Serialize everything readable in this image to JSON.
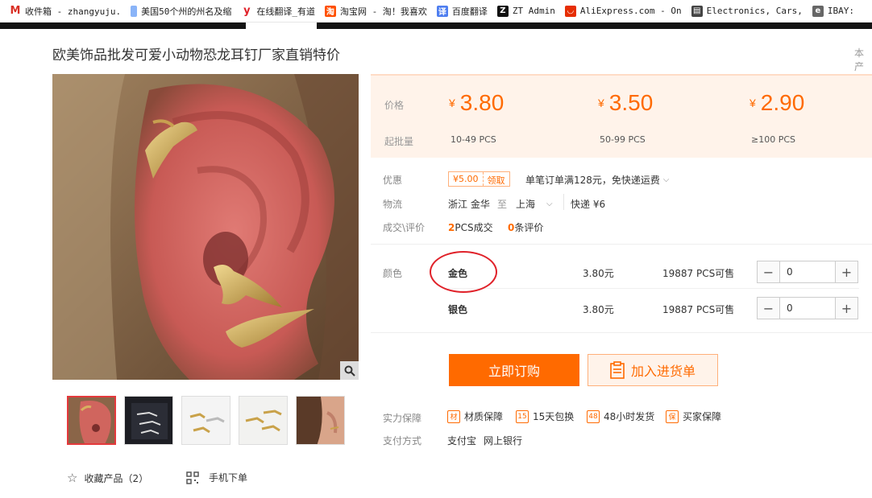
{
  "bookmarks": [
    {
      "icon": "gmail-icon",
      "label": "收件箱 - zhangyuju.",
      "color": "#d93025"
    },
    {
      "icon": "document-icon",
      "label": "美国50个州的州名及缩",
      "color": "#8ab4f8"
    },
    {
      "icon": "youdao-icon",
      "label": "在线翻译_有道",
      "color": "#e0222a"
    },
    {
      "icon": "taobao-icon",
      "label": "淘宝网 - 淘！我喜欢",
      "color": "#ff5000"
    },
    {
      "icon": "baidu-translate-icon",
      "label": "百度翻译",
      "color": "#4e7ef0"
    },
    {
      "icon": "zt-icon",
      "label": "ZT Admin",
      "color": "#111111"
    },
    {
      "icon": "aliexpress-icon",
      "label": "AliExpress.com - On",
      "color": "#e62e04"
    },
    {
      "icon": "electronics-icon",
      "label": "Electronics, Cars,",
      "color": "#444444"
    },
    {
      "icon": "ebay-icon",
      "label": "IBAY:",
      "color": "#666666"
    }
  ],
  "product": {
    "title": "欧美饰品批发可爱小动物恐龙耳钉厂家直销特价",
    "title_right": "本产"
  },
  "price": {
    "price_label": "价格",
    "moq_label": "起批量",
    "currency": "¥",
    "tiers": [
      {
        "price": "3.80",
        "range": "10-49  PCS"
      },
      {
        "price": "3.50",
        "range": "50-99  PCS"
      },
      {
        "price": "2.90",
        "range": "≥100  PCS"
      }
    ]
  },
  "promo": {
    "label": "优惠",
    "coupon_value": "¥5.00",
    "coupon_action": "领取",
    "text": "单笔订单满128元，免快递运费"
  },
  "shipping": {
    "label": "物流",
    "from": "浙江  金华",
    "to_word": "至",
    "to": "上海",
    "method": "快递  ¥6"
  },
  "deals": {
    "label": "成交\\评价",
    "sold_count": "2",
    "sold_text": "PCS成交",
    "review_count": "0",
    "review_text": "条评价"
  },
  "sku": {
    "label": "颜色",
    "options": [
      {
        "name": "金色",
        "price": "3.80元",
        "stock": "19887 PCS可售",
        "qty": "0"
      },
      {
        "name": "银色",
        "price": "3.80元",
        "stock": "19887 PCS可售",
        "qty": "0"
      }
    ]
  },
  "actions": {
    "buy": "立即订购",
    "cart": "加入进货单"
  },
  "guarantee": {
    "label": "实力保障",
    "items": [
      {
        "icon": "material-icon",
        "glyph": "材",
        "text": "材质保障"
      },
      {
        "icon": "return-15-icon",
        "glyph": "15",
        "text": "15天包换"
      },
      {
        "icon": "ship-48-icon",
        "glyph": "48",
        "text": "48小时发货"
      },
      {
        "icon": "buyer-protect-icon",
        "glyph": "保",
        "text": "买家保障"
      }
    ]
  },
  "payment": {
    "label": "支付方式",
    "methods": [
      "支付宝",
      "网上银行"
    ]
  },
  "footer": {
    "collect": "收藏产品（2）",
    "mobile": "手机下单"
  },
  "colors": {
    "accent": "#ff6a00",
    "price_bg": "#fff3ea",
    "annotation": "#e0222a"
  }
}
